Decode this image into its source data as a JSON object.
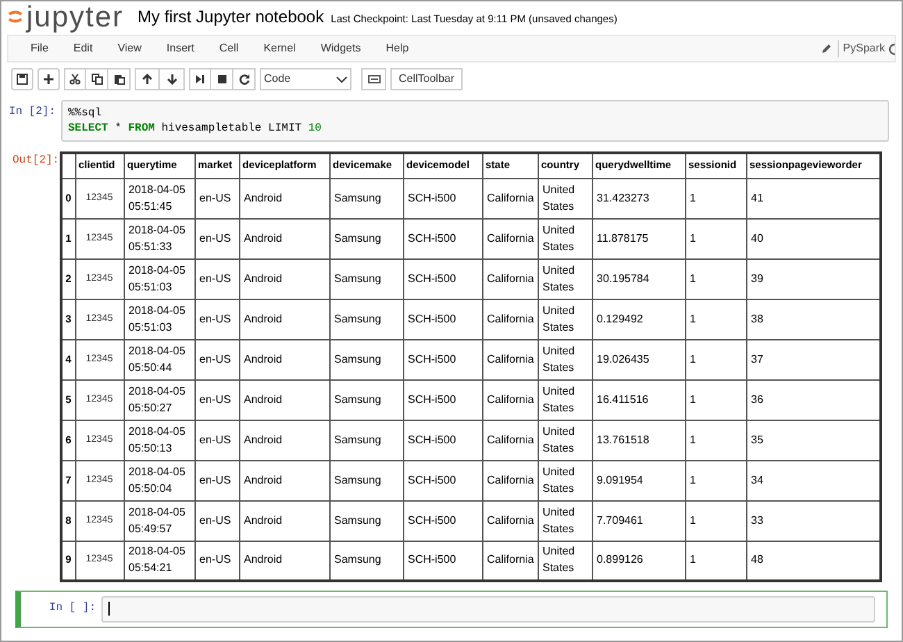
{
  "header": {
    "logo": "jupyter",
    "notebook_title": "My first Jupyter notebook",
    "checkpoint": "Last Checkpoint: Last Tuesday at 9:11 PM (unsaved changes)"
  },
  "menu": [
    "File",
    "Edit",
    "View",
    "Insert",
    "Cell",
    "Kernel",
    "Widgets",
    "Help"
  ],
  "kernel": {
    "name": "PySpark"
  },
  "toolbar": {
    "cell_type": "Code",
    "cell_toolbar": "CellToolbar"
  },
  "cells": [
    {
      "kind": "code",
      "prompt": "In [2]:",
      "selected": false,
      "lines": [
        [
          {
            "text": "%%sql",
            "kind": "plain"
          }
        ],
        [
          {
            "text": "SELECT",
            "kind": "keyword"
          },
          {
            "text": " * ",
            "kind": "plain"
          },
          {
            "text": "FROM",
            "kind": "keyword"
          },
          {
            "text": " hivesampletable LIMIT ",
            "kind": "plain"
          },
          {
            "text": "10",
            "kind": "number"
          }
        ]
      ],
      "output": {
        "prompt": "Out[2]:",
        "table": {
          "columns": [
            "clientid",
            "querytime",
            "market",
            "deviceplatform",
            "devicemake",
            "devicemodel",
            "state",
            "country",
            "querydwelltime",
            "sessionid",
            "sessionpagevieworder"
          ],
          "rows": [
            {
              "index": "0",
              "cells": [
                "12345",
                "2018-04-05 05:51:45",
                "en-US",
                "Android",
                "Samsung",
                "SCH-i500",
                "California",
                "United States",
                "31.423273",
                "1",
                "41"
              ]
            },
            {
              "index": "1",
              "cells": [
                "12345",
                "2018-04-05 05:51:33",
                "en-US",
                "Android",
                "Samsung",
                "SCH-i500",
                "California",
                "United States",
                "11.878175",
                "1",
                "40"
              ]
            },
            {
              "index": "2",
              "cells": [
                "12345",
                "2018-04-05 05:51:03",
                "en-US",
                "Android",
                "Samsung",
                "SCH-i500",
                "California",
                "United States",
                "30.195784",
                "1",
                "39"
              ]
            },
            {
              "index": "3",
              "cells": [
                "12345",
                "2018-04-05 05:51:03",
                "en-US",
                "Android",
                "Samsung",
                "SCH-i500",
                "California",
                "United States",
                "0.129492",
                "1",
                "38"
              ]
            },
            {
              "index": "4",
              "cells": [
                "12345",
                "2018-04-05 05:50:44",
                "en-US",
                "Android",
                "Samsung",
                "SCH-i500",
                "California",
                "United States",
                "19.026435",
                "1",
                "37"
              ]
            },
            {
              "index": "5",
              "cells": [
                "12345",
                "2018-04-05 05:50:27",
                "en-US",
                "Android",
                "Samsung",
                "SCH-i500",
                "California",
                "United States",
                "16.411516",
                "1",
                "36"
              ]
            },
            {
              "index": "6",
              "cells": [
                "12345",
                "2018-04-05 05:50:13",
                "en-US",
                "Android",
                "Samsung",
                "SCH-i500",
                "California",
                "United States",
                "13.761518",
                "1",
                "35"
              ]
            },
            {
              "index": "7",
              "cells": [
                "12345",
                "2018-04-05 05:50:04",
                "en-US",
                "Android",
                "Samsung",
                "SCH-i500",
                "California",
                "United States",
                "9.091954",
                "1",
                "34"
              ]
            },
            {
              "index": "8",
              "cells": [
                "12345",
                "2018-04-05 05:49:57",
                "en-US",
                "Android",
                "Samsung",
                "SCH-i500",
                "California",
                "United States",
                "7.709461",
                "1",
                "33"
              ]
            },
            {
              "index": "9",
              "cells": [
                "12345",
                "2018-04-05 05:54:21",
                "en-US",
                "Android",
                "Samsung",
                "SCH-i500",
                "California",
                "United States",
                "0.899126",
                "1",
                "48"
              ]
            }
          ]
        }
      }
    },
    {
      "kind": "code",
      "prompt": "In [ ]:",
      "selected": true
    }
  ]
}
